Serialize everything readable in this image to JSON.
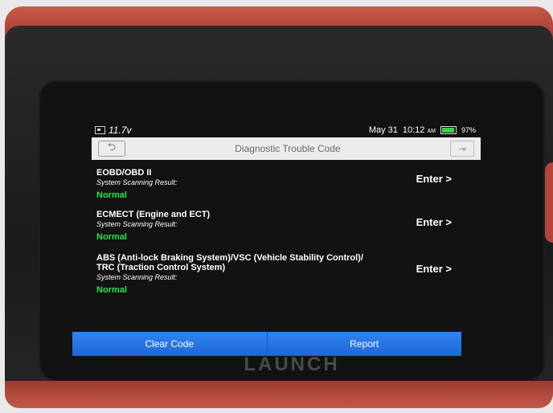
{
  "device": {
    "brand": "LAUNCH"
  },
  "status_bar": {
    "voltage": "11.7v",
    "date": "May 31",
    "time": "10:12",
    "ampm": "AM",
    "battery": "97%"
  },
  "header": {
    "title": "Diagnostic Trouble Code",
    "back_icon": "back-arrow-icon",
    "exit_icon": "exit-icon"
  },
  "systems": [
    {
      "name": "EOBD/OBD II",
      "result_label": "System Scanning Result:",
      "status": "Normal",
      "action": "Enter >"
    },
    {
      "name": "ECMECT (Engine and ECT)",
      "result_label": "System Scanning Result:",
      "status": "Normal",
      "action": "Enter >"
    },
    {
      "name": "ABS (Anti-lock Braking System)/VSC (Vehicle Stability Control)/",
      "name_line2": "TRC (Traction Control System)",
      "result_label": "System Scanning Result:",
      "status": "Normal",
      "action": "Enter >"
    }
  ],
  "buttons": {
    "clear_code": "Clear Code",
    "report": "Report"
  },
  "colors": {
    "status_normal": "#2ee34a",
    "button_blue": "#1f66d8",
    "device_red": "#c25a4b"
  }
}
